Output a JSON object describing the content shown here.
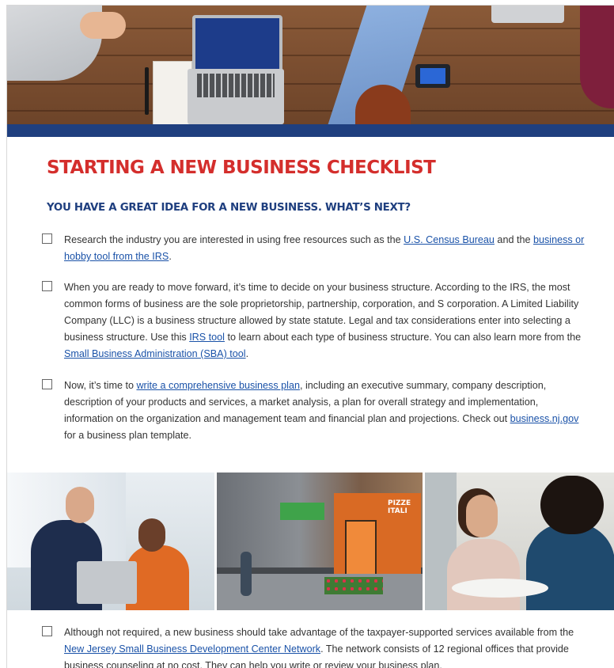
{
  "document": {
    "title": "STARTING A NEW BUSINESS CHECKLIST",
    "subtitle": "YOU HAVE A GREAT IDEA FOR A NEW BUSINESS. WHAT’S NEXT?",
    "colors": {
      "title": "#d42e2c",
      "subtitle": "#1f3f7f",
      "bar": "#1f3f7f",
      "link": "#1a52a8"
    },
    "images": {
      "hero": "overhead-desk-with-laptops-photo",
      "photo1": "business-meeting-at-laptop-photo",
      "photo2": "storefront-street-pizza-shop-photo",
      "photo3": "two-women-talking-at-table-photo"
    },
    "photo2_sign": "PIZZE ITALI",
    "items": [
      {
        "t1": "Research the industry you are interested in using free resources such as the ",
        "link1": "U.S. Census Bureau",
        "t2": " and the ",
        "link2": "business or hobby tool from the IRS",
        "t3": "."
      },
      {
        "t1": "When you are ready to move forward, it’s time to decide on your business structure. According to the IRS, the most common forms of business are the sole proprietorship, partnership, corporation, and S corporation. A Limited Liability Company (LLC) is a business structure allowed by state statute. Legal and tax considerations enter into selecting a business structure. Use this ",
        "link1": "IRS tool",
        "t2": " to learn about each type of business structure. You can also learn more from the ",
        "link2": "Small Business Administration (SBA) tool",
        "t3": "."
      },
      {
        "t1": "Now, it’s time to ",
        "link1": "write a comprehensive business plan",
        "t2": ", including an executive summary, company description, description of your products and services, a market analysis, a plan for overall strategy and implementation, information on the organization and management team and financial plan and projections. Check out ",
        "link2": "business.nj.gov",
        "t3": " for a business plan template."
      },
      {
        "t1": "Although not required, a new business should take advantage of the taxpayer-supported services available from the ",
        "link1": "New Jersey Small Business Development Center Network",
        "t2": ". The network consists of 12 regional offices that provide business counseling at no cost. They can help you write or review your business plan."
      }
    ]
  }
}
